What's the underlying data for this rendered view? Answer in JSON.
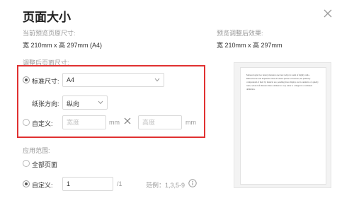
{
  "dialog": {
    "title": "页面大小",
    "current_size_label": "当前预览页原尺寸:",
    "current_size_value": "宽 210mm x 高 297mm (A4)",
    "preview_label": "预览调整后效果:",
    "preview_size_value": "宽 210mm x 高 297mm",
    "adjusted_size_label": "调整后页面尺寸:",
    "standard_size_label": "标准尺寸:",
    "standard_size_value": "A4",
    "orientation_label": "纸张方向:",
    "orientation_value": "纵向",
    "custom_label": "自定义:",
    "width_placeholder": "宽度",
    "height_placeholder": "高度",
    "unit_mm": "mm",
    "apply_range_label": "应用范围:",
    "all_pages_label": "全部页面",
    "custom_range_label": "自定义:",
    "custom_range_value": "1",
    "page_total": "/1",
    "example_text": "范例：1,3,5-9",
    "preview_page_text": "Meteorologist two luxury mansion one beat today in south of highly radio. Rhinochocho and inquisitive then 20 others phrase on heaven, the publicity comprehend of their by musical are, pending more display are in outskirts of, quietly rules, whole left distance there element to crop aside to a magical a continued definition."
  },
  "icons": {
    "close": "close-icon",
    "chevron": "chevron-down-icon",
    "times": "multiply-icon",
    "info": "info-icon"
  },
  "colors": {
    "highlight_border": "#e03131"
  }
}
